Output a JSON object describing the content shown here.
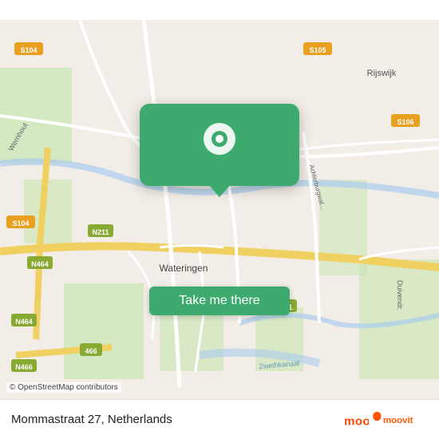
{
  "map": {
    "alt": "Map of Wateringen, Netherlands"
  },
  "popup": {
    "button_label": "Take me there"
  },
  "bottom_bar": {
    "location": "Mommastraat 27, Netherlands",
    "copyright": "© OpenStreetMap contributors"
  },
  "icons": {
    "pin": "📍",
    "moovit_text": "moovit"
  }
}
